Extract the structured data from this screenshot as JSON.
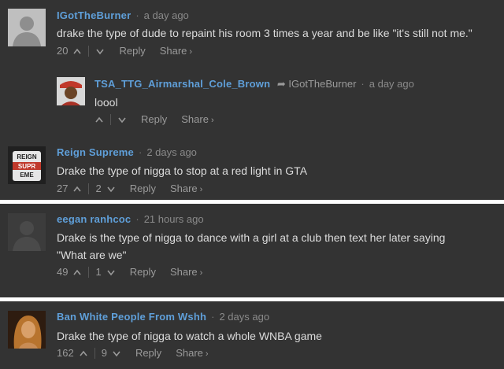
{
  "comments": [
    {
      "author": "IGotTheBurner",
      "time": "a day ago",
      "text": "drake the type of dude to repaint his room 3 times a year and be like \"it's still not me.\"",
      "upvotes": "20",
      "downvotes": "",
      "reply_label": "Reply",
      "share_label": "Share",
      "share_chevron": "›"
    },
    {
      "author": "TSA_TTG_Airmarshal_Cole_Brown",
      "reply_to": "IGotTheBurner",
      "time": "a day ago",
      "text": "loool",
      "upvotes": "",
      "downvotes": "",
      "reply_label": "Reply",
      "share_label": "Share",
      "share_chevron": "›"
    },
    {
      "author": "Reign Supreme",
      "time": "2 days ago",
      "text": "Drake the type of nigga to stop at a red light in GTA",
      "upvotes": "27",
      "downvotes": "2",
      "reply_label": "Reply",
      "share_label": "Share",
      "share_chevron": "›",
      "avatar_text": [
        "REIGN",
        "SUPR",
        "EME"
      ]
    },
    {
      "author": "eegan ranhcoc",
      "time": "21 hours ago",
      "text_line1": "Drake is the type of nigga to dance with a girl at a club then text her later saying",
      "text_line2": "\"What are we\"",
      "upvotes": "49",
      "downvotes": "1",
      "reply_label": "Reply",
      "share_label": "Share",
      "share_chevron": "›"
    },
    {
      "author": "Ban White People From Wshh",
      "time": "2 days ago",
      "text": "Drake the type of nigga to watch a whole WNBA game",
      "upvotes": "162",
      "downvotes": "9",
      "reply_label": "Reply",
      "share_label": "Share",
      "share_chevron": "›"
    }
  ],
  "separator_dot": "·",
  "reply_arrow": "➦",
  "colors": {
    "panel_bg": "#333333",
    "author": "#5f9fd9",
    "body_text": "#dcdcdc",
    "meta_text": "#8a8a8a"
  }
}
